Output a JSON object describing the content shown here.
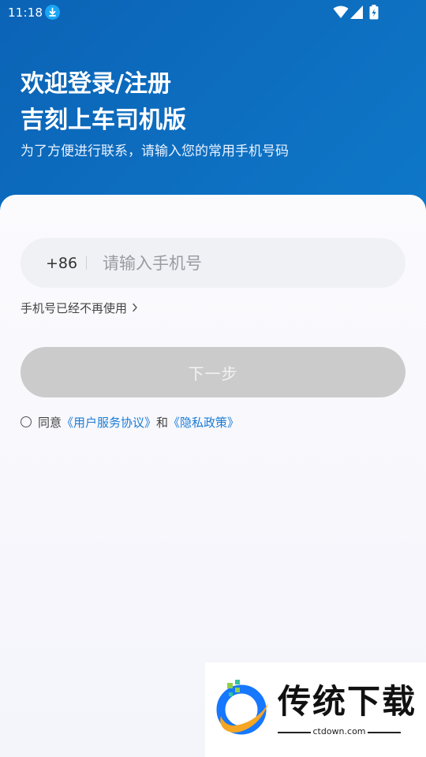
{
  "status_bar": {
    "time": "11:18",
    "icons": [
      "download-icon",
      "wifi-icon",
      "signal-icon",
      "battery-icon"
    ]
  },
  "header": {
    "title_line1": "欢迎登录/注册",
    "title_line2": "吉刻上车司机版",
    "subtitle": "为了方便进行联系，请输入您的常用手机号码"
  },
  "form": {
    "country_code": "+86",
    "phone_value": "",
    "phone_placeholder": "请输入手机号",
    "no_longer_link": "手机号已经不再使用",
    "next_button": "下一步",
    "agree_prefix": "同意",
    "user_agreement": "《用户服务协议》",
    "agree_and": "和",
    "privacy_policy": "《隐私政策》"
  },
  "watermark": {
    "text": "传统下载",
    "url": "ctdown.com"
  },
  "colors": {
    "header_gradient_start": "#0b63b6",
    "header_gradient_end": "#1e87d8",
    "link": "#1a7bd4",
    "button_disabled": "#cbcbcb",
    "input_bg": "#f0f1f4"
  }
}
